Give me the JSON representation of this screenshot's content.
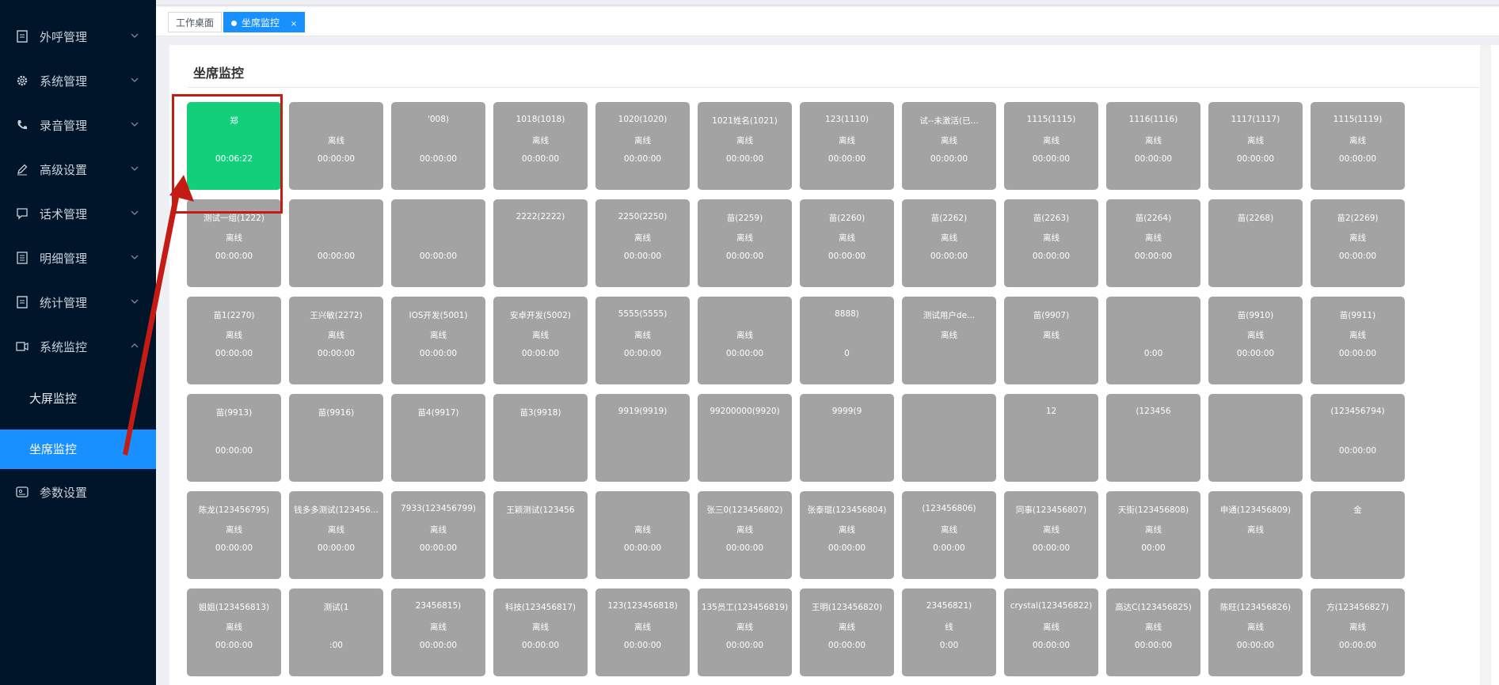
{
  "sidebar": {
    "menu": [
      {
        "label": "外呼管理",
        "icon": "document-icon",
        "open": false
      },
      {
        "label": "系统管理",
        "icon": "gear-icon",
        "open": false
      },
      {
        "label": "录音管理",
        "icon": "phone-icon",
        "open": false
      },
      {
        "label": "高级设置",
        "icon": "edit-icon",
        "open": false
      },
      {
        "label": "话术管理",
        "icon": "chat-icon",
        "open": false
      },
      {
        "label": "明细管理",
        "icon": "list-icon",
        "open": false
      },
      {
        "label": "统计管理",
        "icon": "document-icon",
        "open": false
      },
      {
        "label": "系统监控",
        "icon": "monitor-icon",
        "open": true
      }
    ],
    "submenu": [
      {
        "label": "大屏监控",
        "active": false
      },
      {
        "label": "坐席监控",
        "active": true
      }
    ],
    "last": {
      "label": "参数设置",
      "icon": "settings-icon"
    }
  },
  "tabs": [
    {
      "label": "工作桌面",
      "active": false
    },
    {
      "label": "坐席监控",
      "active": true,
      "close": "×"
    }
  ],
  "page": {
    "title": "坐席监控"
  },
  "agents": [
    [
      {
        "n": "郑",
        "s": "",
        "t": "00:06:22",
        "active": true
      },
      {
        "n": "",
        "s": "离线",
        "t": "00:00:00"
      },
      {
        "n": "'008)",
        "s": "",
        "t": "00:00:00"
      },
      {
        "n": "1018(1018)",
        "s": "离线",
        "t": "00:00:00"
      },
      {
        "n": "1020(1020)",
        "s": "离线",
        "t": "00:00:00"
      },
      {
        "n": "1021姓名(1021)",
        "s": "离线",
        "t": "00:00:00"
      },
      {
        "n": "123(1110)",
        "s": "离线",
        "t": "00:00:00"
      },
      {
        "n": "试--未激活(已...",
        "s": "离线",
        "t": "00:00:00"
      },
      {
        "n": "1115(1115)",
        "s": "离线",
        "t": "00:00:00"
      },
      {
        "n": "1116(1116)",
        "s": "离线",
        "t": "00:00:00"
      },
      {
        "n": "1117(1117)",
        "s": "离线",
        "t": "00:00:00"
      },
      {
        "n": "1115(1119)",
        "s": "离线",
        "t": "00:00:00"
      }
    ],
    [
      {
        "n": "测试一组(1222)",
        "s": "离线",
        "t": "00:00:00"
      },
      {
        "n": "",
        "s": "",
        "t": "00:00:00"
      },
      {
        "n": "",
        "s": "",
        "t": "00:00:00"
      },
      {
        "n": "2222(2222)",
        "s": "",
        "t": ""
      },
      {
        "n": "2250(2250)",
        "s": "离线",
        "t": "00:00:00"
      },
      {
        "n": "苗(2259)",
        "s": "离线",
        "t": "00:00:00"
      },
      {
        "n": "苗(2260)",
        "s": "离线",
        "t": "00:00:00"
      },
      {
        "n": "苗(2262)",
        "s": "离线",
        "t": "00:00:00"
      },
      {
        "n": "苗(2263)",
        "s": "离线",
        "t": "00:00:00"
      },
      {
        "n": "苗(2264)",
        "s": "离线",
        "t": "00:00:00"
      },
      {
        "n": "苗(2268)",
        "s": "",
        "t": ""
      },
      {
        "n": "苗2(2269)",
        "s": "离线",
        "t": "00:00:00"
      }
    ],
    [
      {
        "n": "苗1(2270)",
        "s": "离线",
        "t": "00:00:00"
      },
      {
        "n": "王兴敏(2272)",
        "s": "离线",
        "t": "00:00:00"
      },
      {
        "n": "IOS开发(5001)",
        "s": "离线",
        "t": "00:00:00"
      },
      {
        "n": "安卓开发(5002)",
        "s": "离线",
        "t": "00:00:00"
      },
      {
        "n": "5555(5555)",
        "s": "离线",
        "t": "00:00:00"
      },
      {
        "n": "",
        "s": "离线",
        "t": "00:00:00"
      },
      {
        "n": "8888)",
        "s": "",
        "t": "0"
      },
      {
        "n": "测试用户de...",
        "s": "离线",
        "t": ""
      },
      {
        "n": "苗(9907)",
        "s": "离线",
        "t": ""
      },
      {
        "n": "",
        "s": "",
        "t": "0:00"
      },
      {
        "n": "苗(9910)",
        "s": "离线",
        "t": "00:00:00"
      },
      {
        "n": "苗(9911)",
        "s": "离线",
        "t": "00:00:00"
      }
    ],
    [
      {
        "n": "苗(9913)",
        "s": "",
        "t": "00:00:00"
      },
      {
        "n": "苗(9916)",
        "s": "",
        "t": ""
      },
      {
        "n": "苗4(9917)",
        "s": "",
        "t": ""
      },
      {
        "n": "苗3(9918)",
        "s": "",
        "t": ""
      },
      {
        "n": "9919(9919)",
        "s": "",
        "t": ""
      },
      {
        "n": "99200000(9920)",
        "s": "",
        "t": ""
      },
      {
        "n": "9999(9",
        "s": "",
        "t": ""
      },
      {
        "n": "",
        "s": "",
        "t": ""
      },
      {
        "n": "12",
        "s": "",
        "t": ""
      },
      {
        "n": "(123456",
        "s": "",
        "t": ""
      },
      {
        "n": "",
        "s": "",
        "t": ""
      },
      {
        "n": "(123456794)",
        "s": "",
        "t": "00:00:00"
      }
    ],
    [
      {
        "n": "陈龙(123456795)",
        "s": "离线",
        "t": "00:00:00"
      },
      {
        "n": "钱多多测试(123456...",
        "s": "离线",
        "t": "00:00:00"
      },
      {
        "n": "7933(123456799)",
        "s": "离线",
        "t": "00:00:00"
      },
      {
        "n": "王颖测试(123456",
        "s": "",
        "t": ""
      },
      {
        "n": "",
        "s": "离线",
        "t": "00:00:00"
      },
      {
        "n": "张三0(123456802)",
        "s": "离线",
        "t": "00:00:00"
      },
      {
        "n": "张泰琨(123456804)",
        "s": "离线",
        "t": "00:00:00"
      },
      {
        "n": "(123456806)",
        "s": "离线",
        "t": "0:00:00"
      },
      {
        "n": "同事(123456807)",
        "s": "离线",
        "t": "00:00:00"
      },
      {
        "n": "天街(123456808)",
        "s": "离线",
        "t": "00:00"
      },
      {
        "n": "申通(123456809)",
        "s": "离线",
        "t": ""
      },
      {
        "n": "金",
        "s": "",
        "t": ""
      }
    ],
    [
      {
        "n": "姐姐(123456813)",
        "s": "离线",
        "t": "00:00:00"
      },
      {
        "n": "测试(1",
        "s": "",
        "t": ":00"
      },
      {
        "n": "23456815)",
        "s": "离线",
        "t": "00:00:00"
      },
      {
        "n": "科技(123456817)",
        "s": "离线",
        "t": "00:00:00"
      },
      {
        "n": "123(123456818)",
        "s": "离线",
        "t": "00:00:00"
      },
      {
        "n": "135员工(123456819)",
        "s": "离线",
        "t": "00:00:00"
      },
      {
        "n": "王明(123456820)",
        "s": "离线",
        "t": "00:00:00"
      },
      {
        "n": "23456821)",
        "s": "线",
        "t": "0:00"
      },
      {
        "n": "crystal(123456822)",
        "s": "离线",
        "t": "00:00:00"
      },
      {
        "n": "高达C(123456825)",
        "s": "离线",
        "t": "00:00:00"
      },
      {
        "n": "陈旺(123456826)",
        "s": "离线",
        "t": "00:00:00"
      },
      {
        "n": "方(123456827)",
        "s": "离线",
        "t": "00:00:00"
      }
    ]
  ],
  "colors": {
    "sidebar": "#001529",
    "active": "#1890ff",
    "online": "#13cf7a",
    "offline": "#a3a3a3",
    "highlight": "#c41c14"
  }
}
